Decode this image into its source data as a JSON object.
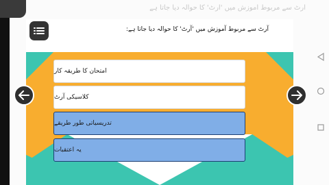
{
  "question": {
    "text": "آرٹ سے مربوط آموزش میں 'آرٹ' کا حوالہ دیا جاتا ہے:",
    "faded_previous_text": "آرٹ سے مربوط آموزش میں 'آرٹ' کا حوالہ دیا جاتا ہے"
  },
  "options": [
    {
      "label": "امتحان کا طریقہ کار",
      "selected": false
    },
    {
      "label": "کلاسیکی آرٹ",
      "selected": false
    },
    {
      "label": "تدریسیاتی طور طریقے",
      "selected": true
    },
    {
      "label": "یہ اعتقبات",
      "selected": true
    }
  ],
  "icons": {
    "menu": "menu-list-icon",
    "prev": "arrow-left-icon",
    "next": "arrow-right-icon",
    "sys_back": "triangle-back-icon",
    "sys_home": "circle-home-icon",
    "sys_recent": "square-recent-icon"
  },
  "colors": {
    "teal": "#3cc5b0",
    "orange": "#f8ad2f",
    "selected_fill": "#80aee7",
    "selected_border": "#1c3f73",
    "button_dark": "#2f2f2f"
  }
}
